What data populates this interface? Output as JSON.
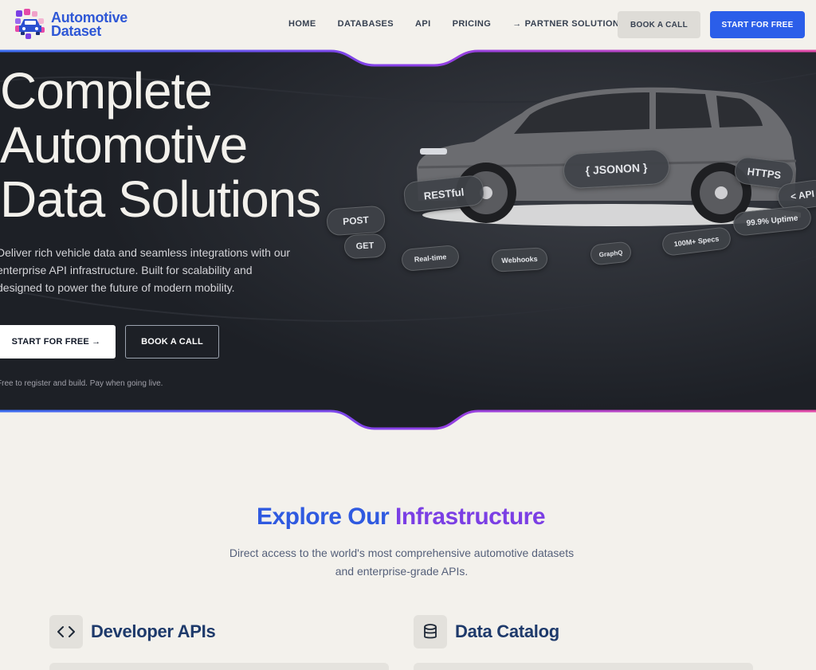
{
  "brand": {
    "line1": "Automotive",
    "line2": "Dataset"
  },
  "nav": {
    "links": [
      "HOME",
      "DATABASES",
      "API",
      "PRICING",
      "PARTNER SOLUTIONS"
    ],
    "partner_arrow": "→",
    "book_call": "BOOK A CALL",
    "start_free": "START FOR FREE"
  },
  "hero": {
    "title_lines": [
      "Complete",
      "Automotive",
      "Data Solutions"
    ],
    "description": "Deliver rich vehicle data and seamless integrations with our enterprise API infrastructure. Built for scalability and designed to power the future of modern mobility.",
    "start_free": "START FOR FREE →",
    "book_call": "BOOK A CALL",
    "note": "Free to register and build. Pay when going live.",
    "pills": [
      "{ JSONON }",
      "HTTPS",
      "RESTful",
      "< API",
      "POST",
      "GET",
      "99.9% Uptime",
      "Real-time",
      "Webhooks",
      "GraphQ",
      "100M+ Specs"
    ]
  },
  "explore": {
    "title_part1": "Explore Our",
    "title_part2": "Infrastructure",
    "subtitle": "Direct access to the world's most comprehensive automotive datasets and enterprise-grade APIs."
  },
  "features": [
    {
      "label": "Developer APIs",
      "icon": "code-icon"
    },
    {
      "label": "Data Catalog",
      "icon": "database-icon"
    }
  ],
  "colors": {
    "accent_blue": "#2b5ee9",
    "accent_purple": "#7b3fe4",
    "hero_bg": "#1f2228",
    "page_bg": "#f3f1ec"
  }
}
